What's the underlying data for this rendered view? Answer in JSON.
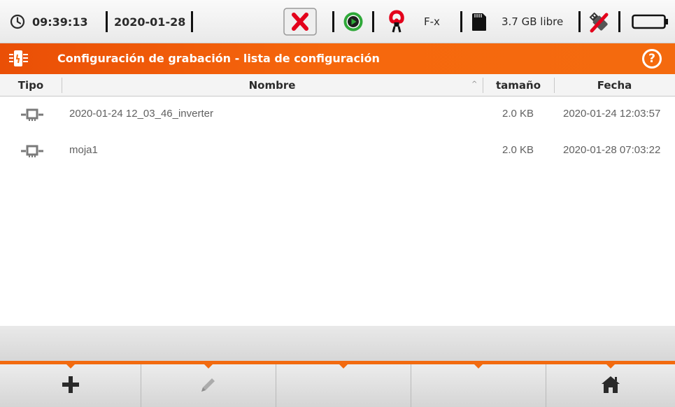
{
  "status_bar": {
    "time": "09:39:13",
    "date": "2020-01-28",
    "clamp_label": "F-x",
    "storage_free": "3.7 GB libre"
  },
  "title_bar": {
    "title": "Configuración de grabación - lista de configuración",
    "help_label": "?"
  },
  "table": {
    "columns": {
      "type": "Tipo",
      "name": "Nombre",
      "size": "tamaño",
      "date": "Fecha"
    },
    "sort_indicator": "^",
    "rows": [
      {
        "name": "2020-01-24 12_03_46_inverter",
        "size": "2.0 KB",
        "date": "2020-01-24 12:03:57",
        "type_icon": "configuration-file-icon"
      },
      {
        "name": "moja1",
        "size": "2.0 KB",
        "date": "2020-01-28 07:03:22",
        "type_icon": "configuration-file-icon"
      }
    ]
  },
  "toolbar": {
    "buttons": [
      {
        "icon": "add-icon"
      },
      {
        "icon": "edit-icon"
      },
      {
        "icon": "empty"
      },
      {
        "icon": "empty"
      },
      {
        "icon": "home-icon"
      }
    ]
  },
  "colors": {
    "accent": "#f26a0f",
    "title_text": "#ffffff",
    "error_red": "#e3001b",
    "record_green": "#2fa839"
  }
}
